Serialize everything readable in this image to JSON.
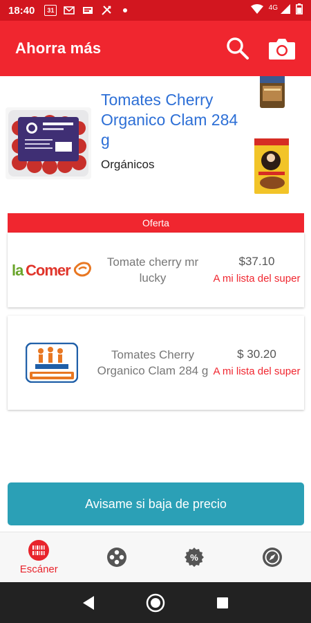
{
  "status_bar": {
    "time": "18:40",
    "calendar_day": "31",
    "network": "4G"
  },
  "app_bar": {
    "title": "Ahorra más",
    "icons": [
      "search-icon",
      "camera-icon"
    ]
  },
  "product": {
    "title": "Tomates Cherry Organico Clam 284 g",
    "subtitle": "Orgánicos"
  },
  "offers": {
    "banner": "Oferta",
    "stores": [
      {
        "store": "laComer",
        "description": "Tomate cherry mr lucky",
        "price": "$37.10",
        "action": "A mi lista del super"
      },
      {
        "store": "Chedraui",
        "description": "Tomates Cherry Organico Clam 284 g",
        "price": "$ 30.20",
        "action": "A mi lista del super"
      }
    ]
  },
  "cta": {
    "label": "Avisame si baja de precio"
  },
  "bottom_nav": {
    "items": [
      {
        "label": "Escáner",
        "icon": "barcode-scanner-icon",
        "active": true
      },
      {
        "label": "",
        "icon": "categories-icon",
        "active": false
      },
      {
        "label": "",
        "icon": "percent-badge-icon",
        "active": false
      },
      {
        "label": "",
        "icon": "compass-icon",
        "active": false
      }
    ]
  },
  "colors": {
    "status_bar": "#d2161f",
    "app_bar": "#f0262f",
    "accent_blue": "#2d6fd6",
    "cta": "#2ba0b6",
    "nav_bar": "#222222"
  }
}
